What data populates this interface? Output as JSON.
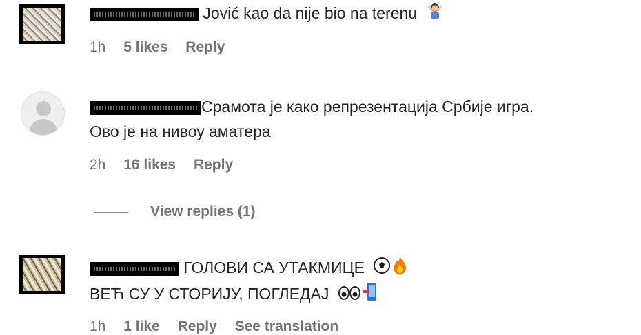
{
  "comments": [
    {
      "username_redacted": true,
      "text_line1": "Jović kao da nije bio na terenu",
      "emoji1": "person-gesturing-no-icon",
      "time": "1h",
      "likes": "5 likes",
      "reply": "Reply"
    },
    {
      "username_redacted": true,
      "text_line1": "Срамота је како репрезентација Србије игра.",
      "text_line2": "Ово је на нивоу аматера",
      "time": "2h",
      "likes": "16 likes",
      "reply": "Reply",
      "view_replies": "View replies (1)"
    },
    {
      "username_redacted": true,
      "text_line1": "ГОЛОВИ СА УТАКМИЦЕ",
      "emoji1": "soccer-ball-icon",
      "emoji2": "fire-icon",
      "text_line2": "ВЕЋ СУ У СТОРИЈУ, ПОГЛЕДАЈ",
      "emoji3": "eyes-icon",
      "emoji4": "phone-arrow-icon",
      "time": "1h",
      "likes": "1 like",
      "reply": "Reply",
      "translate": "See translation"
    }
  ]
}
